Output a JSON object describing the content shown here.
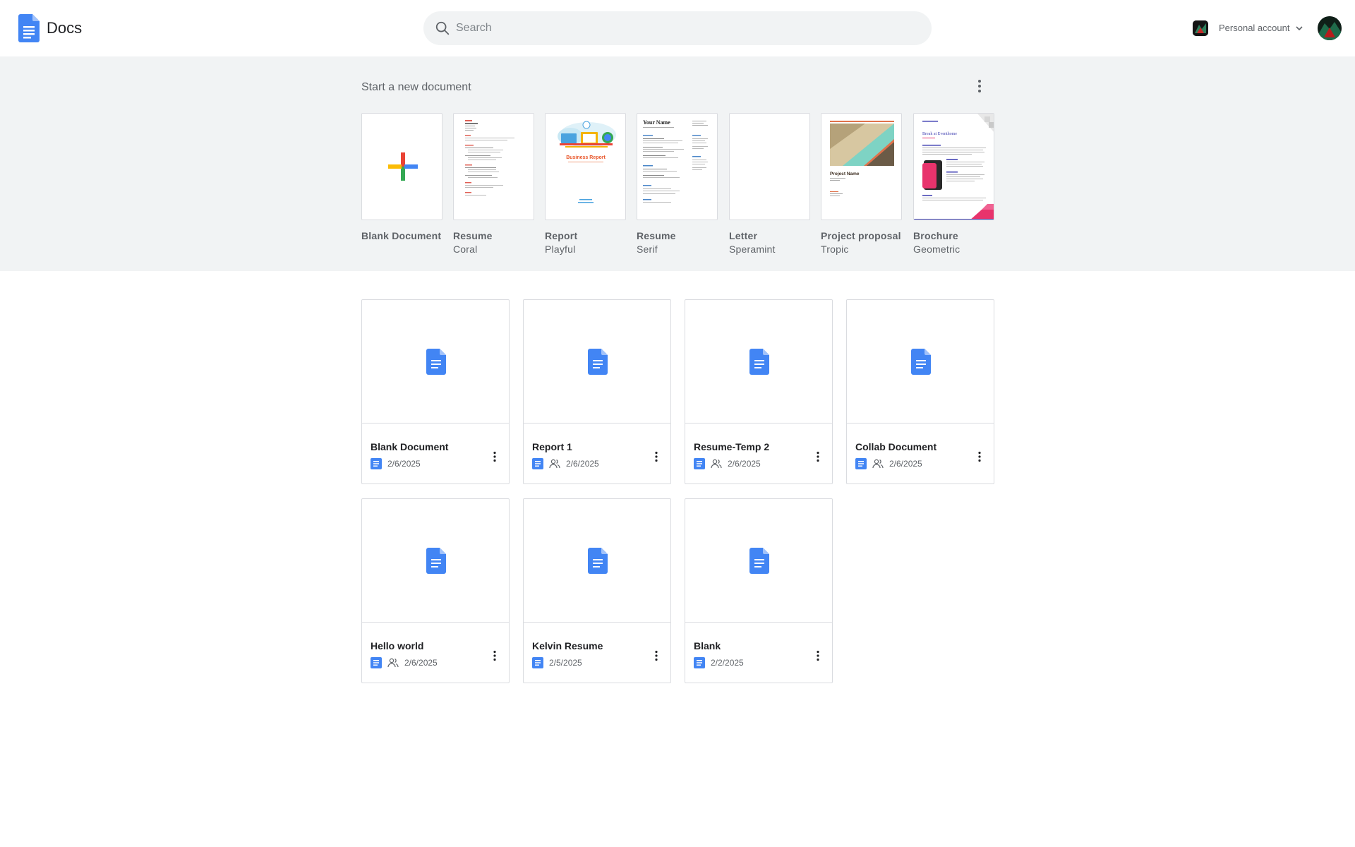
{
  "app": {
    "title": "Docs"
  },
  "search": {
    "placeholder": "Search"
  },
  "account": {
    "label": "Personal account"
  },
  "templates": {
    "heading": "Start a new document",
    "items": [
      {
        "name": "Blank Document",
        "sub": ""
      },
      {
        "name": "Resume",
        "sub": "Coral"
      },
      {
        "name": "Report",
        "sub": "Playful"
      },
      {
        "name": "Resume",
        "sub": "Serif"
      },
      {
        "name": "Letter",
        "sub": "Speramint"
      },
      {
        "name": "Project proposal",
        "sub": "Tropic"
      },
      {
        "name": "Brochure",
        "sub": "Geometric"
      }
    ],
    "thumb_text": {
      "report_title": "Business Report",
      "resume_serif_name": "Your Name",
      "proposal_title": "Project Name",
      "brochure_title": "Break at Eventhome"
    }
  },
  "documents": [
    {
      "title": "Blank Document",
      "date": "2/6/2025",
      "shared": false
    },
    {
      "title": "Report 1",
      "date": "2/6/2025",
      "shared": true
    },
    {
      "title": "Resume-Temp 2",
      "date": "2/6/2025",
      "shared": true
    },
    {
      "title": "Collab Document",
      "date": "2/6/2025",
      "shared": true
    },
    {
      "title": "Hello world",
      "date": "2/6/2025",
      "shared": true
    },
    {
      "title": "Kelvin Resume",
      "date": "2/5/2025",
      "shared": false
    },
    {
      "title": "Blank",
      "date": "2/2/2025",
      "shared": false
    }
  ],
  "colors": {
    "docs_blue": "#4285f4",
    "band_bg": "#f1f3f4",
    "border": "#dadce0",
    "text_secondary": "#5f6368"
  },
  "icons": {
    "logo": "docs-logo-icon",
    "search": "search-icon",
    "chevron": "chevron-down-icon",
    "more": "more-vertical-icon",
    "shared": "people-icon",
    "doc": "doc-icon",
    "plus": "plus-icon"
  }
}
